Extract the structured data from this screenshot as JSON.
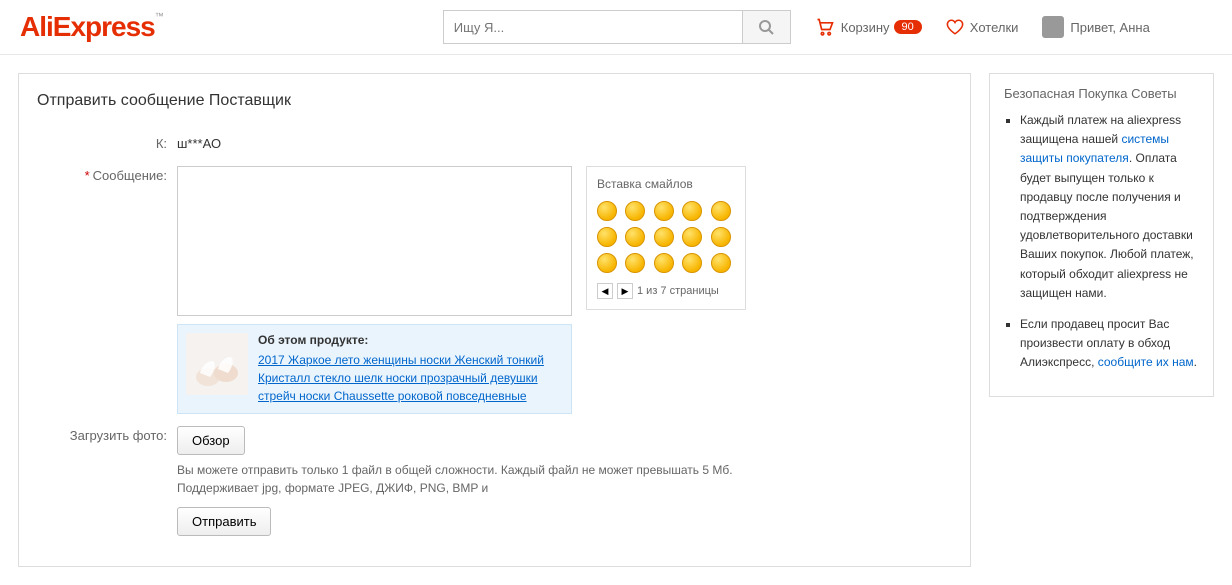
{
  "header": {
    "logo": "AliExpress",
    "search_placeholder": "Ищу Я...",
    "cart_label": "Корзину",
    "cart_count": "90",
    "wish_label": "Хотелки",
    "greeting": "Привет, Анна"
  },
  "form": {
    "title": "Отправить сообщение Поставщик",
    "to_label": "К:",
    "to_value": "ш***АО",
    "message_label": "Сообщение:",
    "smiley_title": "Вставка смайлов",
    "pager_text": "1 из 7 страницы",
    "product_about": "Об этом продукте:",
    "product_link": "2017 Жаркое лето женщины носки Женский тонкий Кристалл стекло шелк носки прозрачный девушки стрейч носки Chaussette роковой повседневные",
    "upload_label": "Загрузить фото:",
    "browse_btn": "Обзор",
    "upload_hint1": "Вы можете отправить только 1 файл в общей сложности. Каждый файл не может превышать 5 Мб.",
    "upload_hint2": "Поддерживает jpg, формате JPEG, ДЖИФ, PNG, BMP и",
    "submit_btn": "Отправить"
  },
  "sidebar": {
    "title": "Безопасная Покупка Советы",
    "tip1_p1": "Каждый платеж на aliexpress защищена нашей ",
    "tip1_link": "системы защиты покупателя",
    "tip1_p2": ". Оплата будет выпущен только к продавцу после получения и подтверждения удовлетворительного доставки Ваших покупок. Любой платеж, который обходит aliexpress не защищен нами.",
    "tip2_p1": "Если продавец просит Вас произвести оплату в обход Алиэкспресс, ",
    "tip2_link": "сообщите их нам",
    "tip2_p2": "."
  }
}
